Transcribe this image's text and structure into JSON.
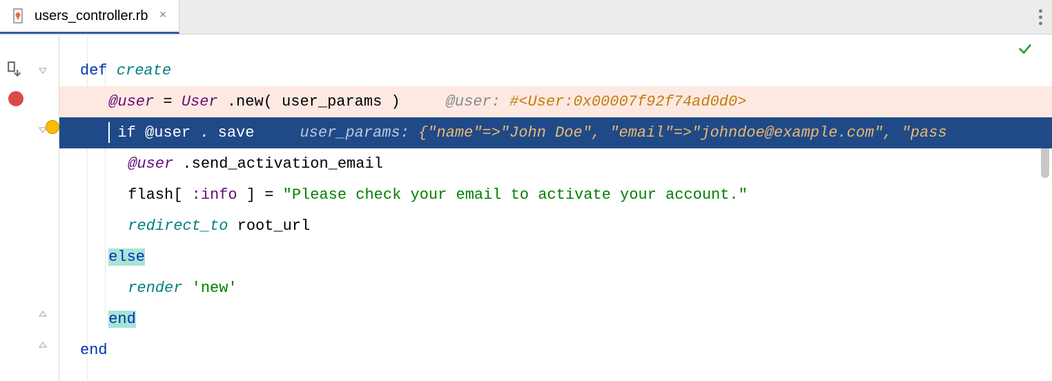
{
  "tab": {
    "filename": "users_controller.rb",
    "close_hint": "×"
  },
  "lines": {
    "l1": {
      "kw": "def",
      "method": "create"
    },
    "l2": {
      "at_user": "@user",
      "eq": " = ",
      "classname": "User",
      "dot": ".new(",
      "params": "user_params",
      "close": ")",
      "hint_label": "@user:",
      "hint_val": "#<User:0x00007f92f74ad0d0>"
    },
    "l3": {
      "kw_if": "if",
      "at_user": "@user",
      "dot": ".",
      "save": "save",
      "hint_label": "user_params:",
      "hint_val": "{\"name\"=>\"John Doe\", \"email\"=>\"johndoe@example.com\", \"pass"
    },
    "l4": {
      "at_user": "@user",
      "call": ".send_activation_email"
    },
    "l5": {
      "flash": "flash[",
      "sym": ":info",
      "bracket": "] = ",
      "str": "\"Please check your email to activate your account.\""
    },
    "l6": {
      "redirect": "redirect_to",
      "root": " root_url"
    },
    "l7": {
      "else": "else"
    },
    "l8": {
      "render": "render",
      "newq": "'new'"
    },
    "l9": {
      "end": "end"
    },
    "l10": {
      "end": "end"
    }
  }
}
